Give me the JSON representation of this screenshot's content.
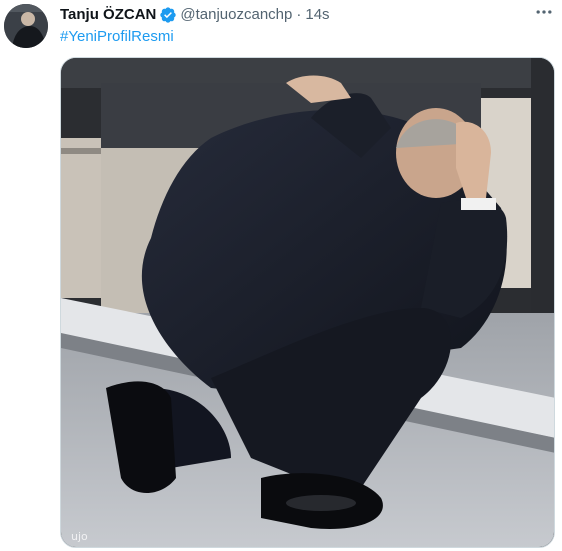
{
  "tweet": {
    "author_name": "Tanju ÖZCAN",
    "handle": "@tanjuozcanchp",
    "separator": "·",
    "time": "14s",
    "hashtag": "#YeniProfilResmi",
    "verified_icon": "verified-badge-icon",
    "more_icon": "more-horizontal-icon",
    "accent_color": "#1d9bf0"
  },
  "media": {
    "watermark": "ujo"
  }
}
